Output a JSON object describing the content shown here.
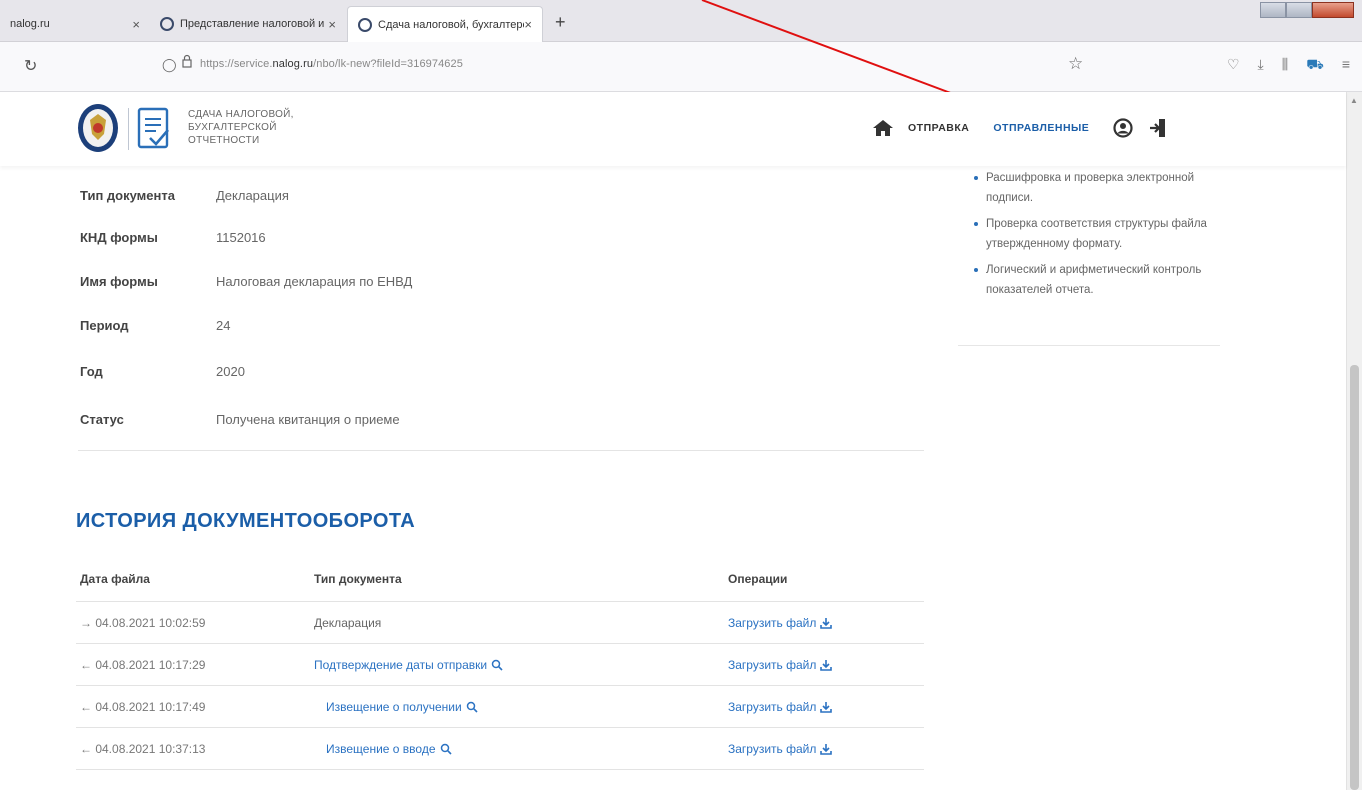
{
  "browser": {
    "tabs": [
      {
        "title": "nalog.ru",
        "close": "×"
      },
      {
        "title": "Представление налоговой и",
        "close": "×"
      },
      {
        "title": "Сдача налоговой, бухгалтерс",
        "close": "×"
      }
    ],
    "new_tab": "+",
    "url": {
      "prefix": "https://service.",
      "domain": "nalog.ru",
      "suffix": "/nbo/lk-new?fileId=316974625"
    }
  },
  "header": {
    "brand_lines": [
      "СДАЧА НАЛОГОВОЙ,",
      "БУХГАЛТЕРСКОЙ",
      "ОТЧЕТНОСТИ"
    ],
    "nav": {
      "send": "ОТПРАВКА",
      "sent": "ОТПРАВЛЕННЫЕ"
    }
  },
  "document": {
    "fields": [
      {
        "label": "Тип документа",
        "value": "Декларация"
      },
      {
        "label": "КНД формы",
        "value": "1152016"
      },
      {
        "label": "Имя формы",
        "value": "Налоговая декларация по ЕНВД"
      },
      {
        "label": "Период",
        "value": "24"
      },
      {
        "label": "Год",
        "value": "2020"
      },
      {
        "label": "Статус",
        "value": "Получена квитанция о приеме"
      }
    ]
  },
  "aside": {
    "items": [
      "Расшифровка и проверка электронной подписи.",
      "Проверка соответствия структуры файла утвержденному формату.",
      "Логический и арифметический контроль показателей отчета."
    ]
  },
  "history": {
    "title": "ИСТОРИЯ ДОКУМЕНТООБОРОТА",
    "columns": [
      "Дата файла",
      "Тип документа",
      "Операции"
    ],
    "rows": [
      {
        "date": "→ 04.08.2021 10:02:59",
        "type": "Декларация",
        "type_link": false,
        "op": "Загрузить файл"
      },
      {
        "date": "← 04.08.2021 10:17:29",
        "type": "Подтверждение даты отправки",
        "type_link": true,
        "op": "Загрузить файл"
      },
      {
        "date": "← 04.08.2021 10:17:49",
        "type": "Извещение о получении",
        "type_link": true,
        "op": "Загрузить файл"
      },
      {
        "date": "← 04.08.2021 10:37:13",
        "type": "Извещение о вводе",
        "type_link": true,
        "op": "Загрузить файл"
      }
    ]
  },
  "colors": {
    "accent": "#1b5ea8",
    "link": "#2b72c2",
    "annotation_arrow": "#e01010"
  }
}
